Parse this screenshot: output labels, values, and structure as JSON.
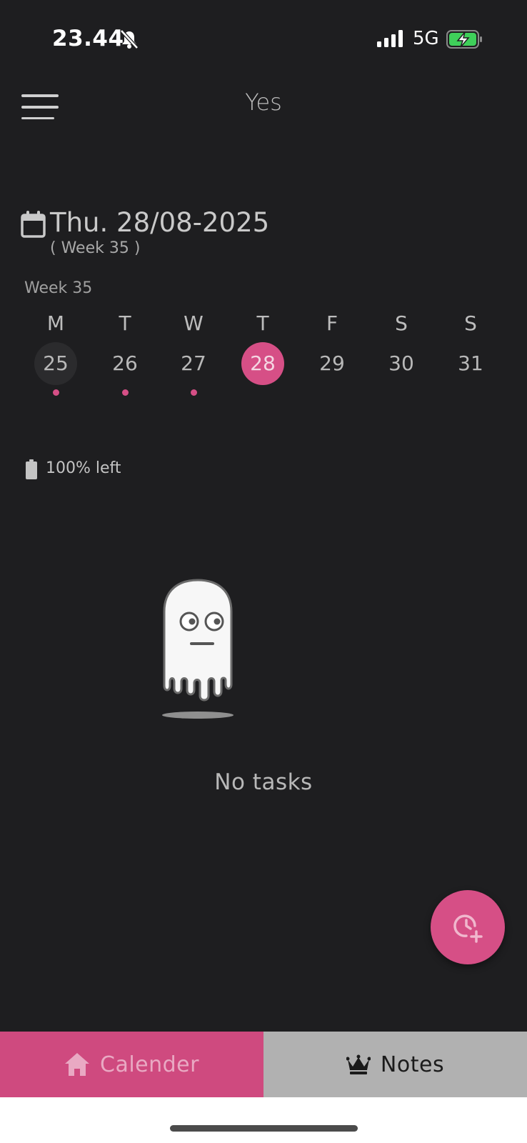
{
  "status_bar": {
    "time": "23.44",
    "network": "5G"
  },
  "header": {
    "title": "Yes"
  },
  "date": {
    "title": "Thu. 28/08-2025",
    "week_note": "( Week 35 )",
    "week_label": "Week 35"
  },
  "week": {
    "days": [
      {
        "letter": "M",
        "num": "25",
        "state": "past",
        "dot": true
      },
      {
        "letter": "T",
        "num": "26",
        "state": "normal",
        "dot": true
      },
      {
        "letter": "W",
        "num": "27",
        "state": "normal",
        "dot": true
      },
      {
        "letter": "T",
        "num": "28",
        "state": "today",
        "dot": false
      },
      {
        "letter": "F",
        "num": "29",
        "state": "normal",
        "dot": false
      },
      {
        "letter": "S",
        "num": "30",
        "state": "normal",
        "dot": false
      },
      {
        "letter": "S",
        "num": "31",
        "state": "normal",
        "dot": false
      }
    ]
  },
  "battery": {
    "left_text": "100% left"
  },
  "empty_state": {
    "text": "No tasks"
  },
  "nav": {
    "calendar_label": "Calender",
    "notes_label": "Notes"
  },
  "colors": {
    "accent": "#d64f86",
    "background": "#1e1e20",
    "nav_inactive": "#b1b1b1"
  }
}
